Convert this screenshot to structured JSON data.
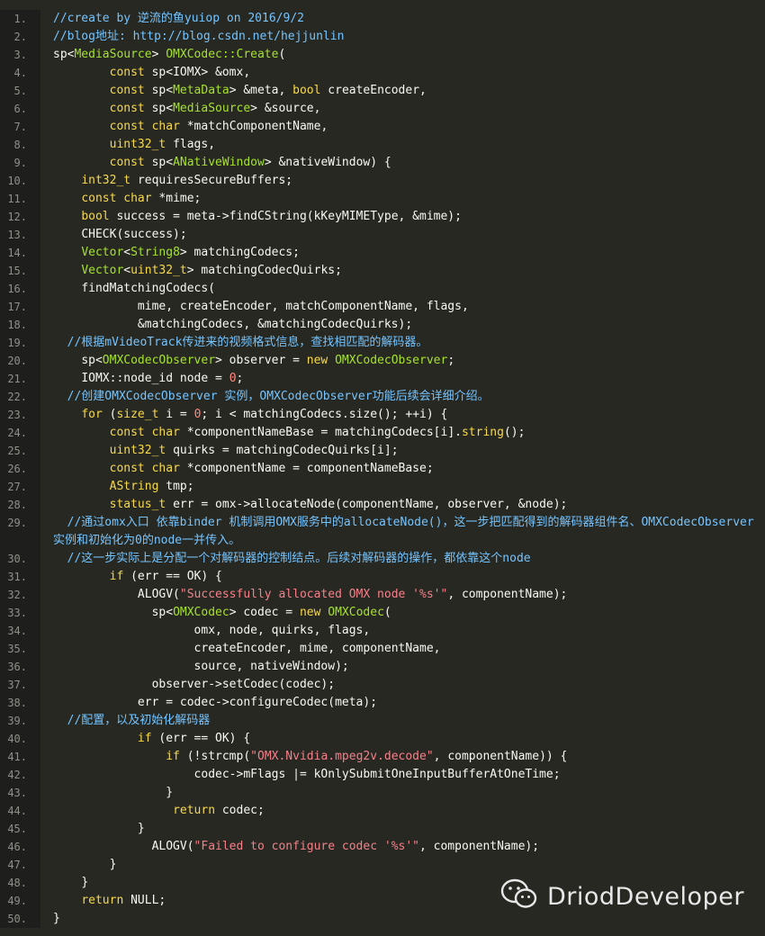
{
  "lines": [
    {
      "n": "1.",
      "tokens": [
        {
          "c": "c",
          "t": "//create by 逆流的鱼yuiop on 2016/9/2"
        }
      ]
    },
    {
      "n": "2.",
      "tokens": [
        {
          "c": "c",
          "t": "//blog地址: http://blog.csdn.net/hejjunlin"
        }
      ]
    },
    {
      "n": "3.",
      "tokens": [
        {
          "c": "p",
          "t": "sp<"
        },
        {
          "c": "t",
          "t": "MediaSource"
        },
        {
          "c": "p",
          "t": "> "
        },
        {
          "c": "t",
          "t": "OMXCodec::Create"
        },
        {
          "c": "p",
          "t": "("
        }
      ]
    },
    {
      "n": "4.",
      "tokens": [
        {
          "c": "p",
          "t": "        "
        },
        {
          "c": "k",
          "t": "const"
        },
        {
          "c": "p",
          "t": " sp<IOMX> &omx,"
        }
      ]
    },
    {
      "n": "5.",
      "tokens": [
        {
          "c": "p",
          "t": "        "
        },
        {
          "c": "k",
          "t": "const"
        },
        {
          "c": "p",
          "t": " sp<"
        },
        {
          "c": "t",
          "t": "MetaData"
        },
        {
          "c": "p",
          "t": "> &meta, "
        },
        {
          "c": "k",
          "t": "bool"
        },
        {
          "c": "p",
          "t": " createEncoder,"
        }
      ]
    },
    {
      "n": "6.",
      "tokens": [
        {
          "c": "p",
          "t": "        "
        },
        {
          "c": "k",
          "t": "const"
        },
        {
          "c": "p",
          "t": " sp<"
        },
        {
          "c": "t",
          "t": "MediaSource"
        },
        {
          "c": "p",
          "t": "> &source,"
        }
      ]
    },
    {
      "n": "7.",
      "tokens": [
        {
          "c": "p",
          "t": "        "
        },
        {
          "c": "k",
          "t": "const char"
        },
        {
          "c": "p",
          "t": " *matchComponentName,"
        }
      ]
    },
    {
      "n": "8.",
      "tokens": [
        {
          "c": "p",
          "t": "        "
        },
        {
          "c": "k",
          "t": "uint32_t"
        },
        {
          "c": "p",
          "t": " flags,"
        }
      ]
    },
    {
      "n": "9.",
      "tokens": [
        {
          "c": "p",
          "t": "        "
        },
        {
          "c": "k",
          "t": "const"
        },
        {
          "c": "p",
          "t": " sp<"
        },
        {
          "c": "t",
          "t": "ANativeWindow"
        },
        {
          "c": "p",
          "t": "> &nativeWindow) {"
        }
      ]
    },
    {
      "n": "10.",
      "tokens": [
        {
          "c": "p",
          "t": "    "
        },
        {
          "c": "k",
          "t": "int32_t"
        },
        {
          "c": "p",
          "t": " requiresSecureBuffers;"
        }
      ]
    },
    {
      "n": "11.",
      "tokens": [
        {
          "c": "p",
          "t": "    "
        },
        {
          "c": "k",
          "t": "const char"
        },
        {
          "c": "p",
          "t": " *mime;"
        }
      ]
    },
    {
      "n": "12.",
      "tokens": [
        {
          "c": "p",
          "t": "    "
        },
        {
          "c": "k",
          "t": "bool"
        },
        {
          "c": "p",
          "t": " success = meta->findCString(kKeyMIMEType, &mime);"
        }
      ]
    },
    {
      "n": "13.",
      "tokens": [
        {
          "c": "p",
          "t": "    CHECK(success);"
        }
      ]
    },
    {
      "n": "14.",
      "tokens": [
        {
          "c": "p",
          "t": "    "
        },
        {
          "c": "t",
          "t": "Vector"
        },
        {
          "c": "p",
          "t": "<"
        },
        {
          "c": "t",
          "t": "String8"
        },
        {
          "c": "p",
          "t": "> matchingCodecs;"
        }
      ]
    },
    {
      "n": "15.",
      "tokens": [
        {
          "c": "p",
          "t": "    "
        },
        {
          "c": "t",
          "t": "Vector"
        },
        {
          "c": "p",
          "t": "<"
        },
        {
          "c": "k",
          "t": "uint32_t"
        },
        {
          "c": "p",
          "t": "> matchingCodecQuirks;"
        }
      ]
    },
    {
      "n": "16.",
      "tokens": [
        {
          "c": "p",
          "t": "    findMatchingCodecs("
        }
      ]
    },
    {
      "n": "17.",
      "tokens": [
        {
          "c": "p",
          "t": "            mime, createEncoder, matchComponentName, flags,"
        }
      ]
    },
    {
      "n": "18.",
      "tokens": [
        {
          "c": "p",
          "t": "            &matchingCodecs, &matchingCodecQuirks);"
        }
      ]
    },
    {
      "n": "19.",
      "tokens": [
        {
          "c": "c",
          "t": "  //根据mVideoTrack传进来的视频格式信息，查找相匹配的解码器。"
        }
      ]
    },
    {
      "n": "20.",
      "tokens": [
        {
          "c": "p",
          "t": "    sp<"
        },
        {
          "c": "t",
          "t": "OMXCodecObserver"
        },
        {
          "c": "p",
          "t": "> observer = "
        },
        {
          "c": "k",
          "t": "new"
        },
        {
          "c": "p",
          "t": " "
        },
        {
          "c": "t",
          "t": "OMXCodecObserver"
        },
        {
          "c": "p",
          "t": ";"
        }
      ]
    },
    {
      "n": "21.",
      "tokens": [
        {
          "c": "p",
          "t": "    IOMX::node_id node = "
        },
        {
          "c": "n",
          "t": "0"
        },
        {
          "c": "p",
          "t": ";"
        }
      ]
    },
    {
      "n": "22.",
      "tokens": [
        {
          "c": "c",
          "t": "  //创建OMXCodecObserver 实例，OMXCodecObserver功能后续会详细介绍。"
        }
      ]
    },
    {
      "n": "23.",
      "tokens": [
        {
          "c": "p",
          "t": "    "
        },
        {
          "c": "k",
          "t": "for"
        },
        {
          "c": "p",
          "t": " ("
        },
        {
          "c": "k",
          "t": "size_t"
        },
        {
          "c": "p",
          "t": " i = "
        },
        {
          "c": "n",
          "t": "0"
        },
        {
          "c": "p",
          "t": "; i < matchingCodecs.size(); ++i) {"
        }
      ]
    },
    {
      "n": "24.",
      "tokens": [
        {
          "c": "p",
          "t": "        "
        },
        {
          "c": "k",
          "t": "const char"
        },
        {
          "c": "p",
          "t": " *componentNameBase = matchingCodecs[i]."
        },
        {
          "c": "k",
          "t": "string"
        },
        {
          "c": "p",
          "t": "();"
        }
      ]
    },
    {
      "n": "25.",
      "tokens": [
        {
          "c": "p",
          "t": "        "
        },
        {
          "c": "k",
          "t": "uint32_t"
        },
        {
          "c": "p",
          "t": " quirks = matchingCodecQuirks[i];"
        }
      ]
    },
    {
      "n": "26.",
      "tokens": [
        {
          "c": "p",
          "t": "        "
        },
        {
          "c": "k",
          "t": "const char"
        },
        {
          "c": "p",
          "t": " *componentName = componentNameBase;"
        }
      ]
    },
    {
      "n": "27.",
      "tokens": [
        {
          "c": "p",
          "t": "        "
        },
        {
          "c": "k",
          "t": "AString"
        },
        {
          "c": "p",
          "t": " tmp;"
        }
      ]
    },
    {
      "n": "28.",
      "tokens": [
        {
          "c": "p",
          "t": "        "
        },
        {
          "c": "k",
          "t": "status_t"
        },
        {
          "c": "p",
          "t": " err = omx->allocateNode(componentName, observer, &node);"
        }
      ]
    },
    {
      "n": "29.",
      "wrapped": true,
      "tokens": [
        {
          "c": "c",
          "t": "  //通过omx入口 依靠binder 机制调用OMX服务中的allocateNode()，这一步把匹配得到的解码器组件名、OMXCodecObserver实例和初始化为0的node一并传入。"
        }
      ]
    },
    {
      "n": "30.",
      "tokens": [
        {
          "c": "c",
          "t": "  //这一步实际上是分配一个对解码器的控制结点。后续对解码器的操作，都依靠这个node"
        }
      ]
    },
    {
      "n": "31.",
      "tokens": [
        {
          "c": "p",
          "t": "        "
        },
        {
          "c": "k",
          "t": "if"
        },
        {
          "c": "p",
          "t": " (err == OK) {"
        }
      ]
    },
    {
      "n": "32.",
      "tokens": [
        {
          "c": "p",
          "t": "            ALOGV("
        },
        {
          "c": "s",
          "t": "\"Successfully allocated OMX node '%s'\""
        },
        {
          "c": "p",
          "t": ", componentName);"
        }
      ]
    },
    {
      "n": "33.",
      "tokens": [
        {
          "c": "p",
          "t": "              sp<"
        },
        {
          "c": "t",
          "t": "OMXCodec"
        },
        {
          "c": "p",
          "t": "> codec = "
        },
        {
          "c": "k",
          "t": "new"
        },
        {
          "c": "p",
          "t": " "
        },
        {
          "c": "t",
          "t": "OMXCodec"
        },
        {
          "c": "p",
          "t": "("
        }
      ]
    },
    {
      "n": "34.",
      "tokens": [
        {
          "c": "p",
          "t": "                    omx, node, quirks, flags,"
        }
      ]
    },
    {
      "n": "35.",
      "tokens": [
        {
          "c": "p",
          "t": "                    createEncoder, mime, componentName,"
        }
      ]
    },
    {
      "n": "36.",
      "tokens": [
        {
          "c": "p",
          "t": "                    source, nativeWindow);"
        }
      ]
    },
    {
      "n": "37.",
      "tokens": [
        {
          "c": "p",
          "t": "              observer->setCodec(codec);"
        }
      ]
    },
    {
      "n": "38.",
      "tokens": [
        {
          "c": "p",
          "t": "            err = codec->configureCodec(meta);"
        }
      ]
    },
    {
      "n": "39.",
      "tokens": [
        {
          "c": "c",
          "t": "  //配置，以及初始化解码器"
        }
      ]
    },
    {
      "n": "40.",
      "tokens": [
        {
          "c": "p",
          "t": "            "
        },
        {
          "c": "k",
          "t": "if"
        },
        {
          "c": "p",
          "t": " (err == OK) {"
        }
      ]
    },
    {
      "n": "41.",
      "tokens": [
        {
          "c": "p",
          "t": "                "
        },
        {
          "c": "k",
          "t": "if"
        },
        {
          "c": "p",
          "t": " (!strcmp("
        },
        {
          "c": "s",
          "t": "\"OMX.Nvidia.mpeg2v.decode\""
        },
        {
          "c": "p",
          "t": ", componentName)) {"
        }
      ]
    },
    {
      "n": "42.",
      "tokens": [
        {
          "c": "p",
          "t": "                    codec->mFlags |= kOnlySubmitOneInputBufferAtOneTime;"
        }
      ]
    },
    {
      "n": "43.",
      "tokens": [
        {
          "c": "p",
          "t": "                }"
        }
      ]
    },
    {
      "n": "44.",
      "tokens": [
        {
          "c": "p",
          "t": "                 "
        },
        {
          "c": "k",
          "t": "return"
        },
        {
          "c": "p",
          "t": " codec;"
        }
      ]
    },
    {
      "n": "45.",
      "tokens": [
        {
          "c": "p",
          "t": "            }"
        }
      ]
    },
    {
      "n": "46.",
      "tokens": [
        {
          "c": "p",
          "t": "              ALOGV("
        },
        {
          "c": "s",
          "t": "\"Failed to configure codec '%s'\""
        },
        {
          "c": "p",
          "t": ", componentName);"
        }
      ]
    },
    {
      "n": "47.",
      "tokens": [
        {
          "c": "p",
          "t": "        }"
        }
      ]
    },
    {
      "n": "48.",
      "tokens": [
        {
          "c": "p",
          "t": "    }"
        }
      ]
    },
    {
      "n": "49.",
      "tokens": [
        {
          "c": "p",
          "t": "    "
        },
        {
          "c": "k",
          "t": "return"
        },
        {
          "c": "p",
          "t": " NULL;"
        }
      ]
    },
    {
      "n": "50.",
      "tokens": [
        {
          "c": "p",
          "t": "}"
        }
      ]
    }
  ],
  "watermark": {
    "text": "DriodDeveloper",
    "icon": "wechat-icon"
  },
  "colors": {
    "background": "#272822",
    "gutter": "#1e1f1c",
    "comment": "#75c4ff",
    "keyword": "#f7d94c",
    "type": "#a6e22e",
    "string": "#f4808a",
    "text": "#f8f8f2"
  }
}
